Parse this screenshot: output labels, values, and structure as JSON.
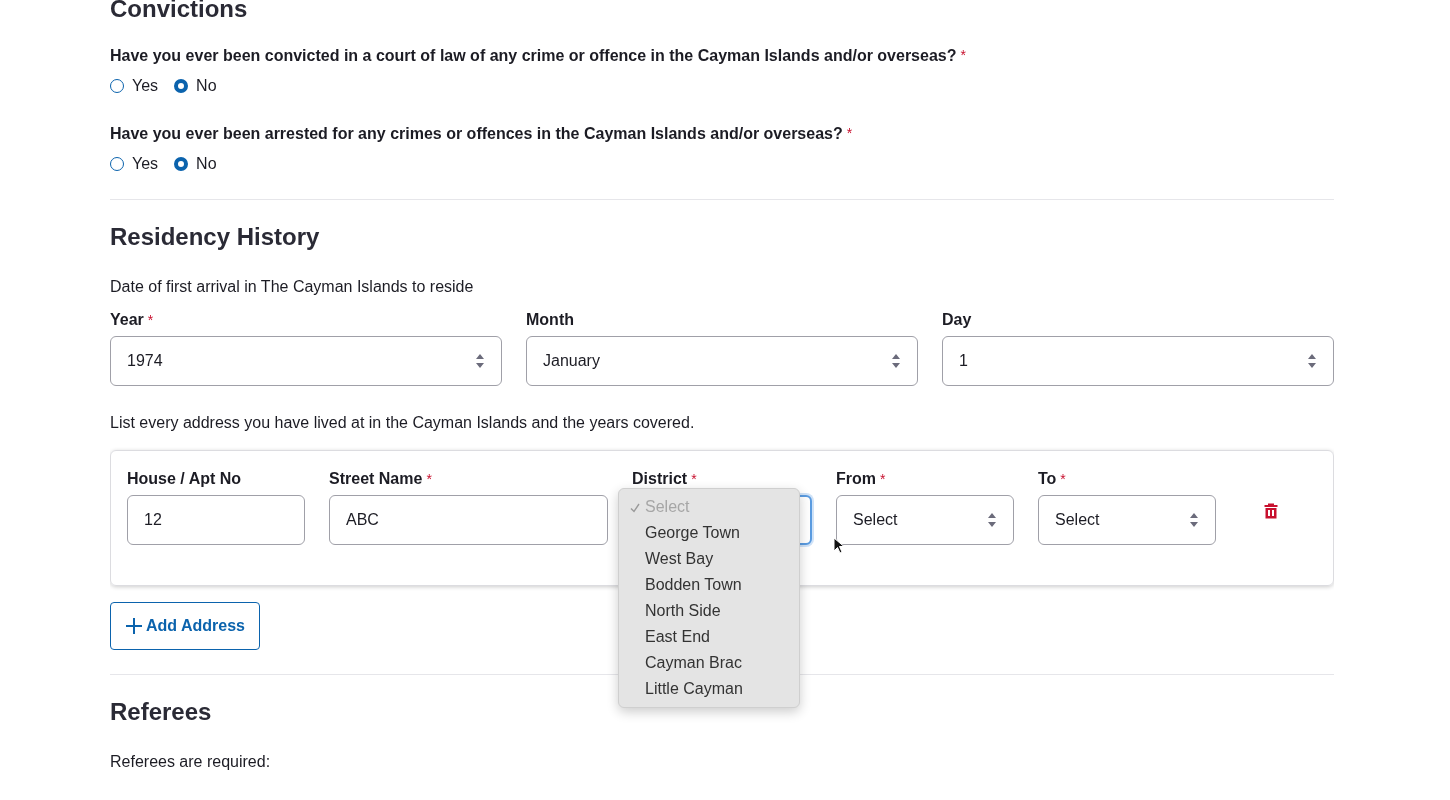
{
  "convictions": {
    "title": "Convictions",
    "questions": [
      {
        "text": "Have you ever been convicted in a court of law of any crime or offence in the Cayman Islands and/or overseas?",
        "mark": "*",
        "options": [
          {
            "label": "Yes",
            "selected": false
          },
          {
            "label": "No",
            "selected": true
          }
        ]
      },
      {
        "text": "Have you ever been arrested for any crimes or offences in the Cayman Islands and/or overseas?",
        "mark": "*",
        "options": [
          {
            "label": "Yes",
            "selected": false
          },
          {
            "label": "No",
            "selected": true
          }
        ]
      }
    ]
  },
  "residency": {
    "title": "Residency History",
    "arrival_text": "Date of first arrival in The Cayman Islands to reside",
    "date_fields": [
      {
        "label": "Year",
        "mark": "*",
        "value": "1974"
      },
      {
        "label": "Month",
        "value": "January"
      },
      {
        "label": "Day",
        "value": "1"
      }
    ],
    "address_text": "List every address you have lived at in the Cayman Islands and the years covered.",
    "address_fields": [
      {
        "label": "House / Apt No",
        "kind": "text",
        "value": "12"
      },
      {
        "label": "Street Name",
        "mark": "*",
        "kind": "text",
        "value": "ABC"
      },
      {
        "label": "District",
        "mark": "*",
        "kind": "select",
        "focused": true,
        "menu": [
          {
            "label": "Select",
            "selected": true,
            "disabled": true
          },
          {
            "label": "George Town",
            "selected": false,
            "disabled": false
          },
          {
            "label": "West Bay",
            "selected": false,
            "disabled": false
          },
          {
            "label": "Bodden Town",
            "selected": false,
            "disabled": false
          },
          {
            "label": "North Side",
            "selected": false,
            "disabled": false
          },
          {
            "label": "East End",
            "selected": false,
            "disabled": false
          },
          {
            "label": "Cayman Brac",
            "selected": false,
            "disabled": false
          },
          {
            "label": "Little Cayman",
            "selected": false,
            "disabled": false
          }
        ]
      },
      {
        "label": "From",
        "mark": "*",
        "kind": "select",
        "focused": false,
        "value": "Select"
      },
      {
        "label": "To",
        "mark": "*",
        "kind": "select",
        "focused": false,
        "value": "Select"
      }
    ],
    "add_button": "Add Address"
  },
  "referees": {
    "title": "Referees",
    "text": "Referees are required:"
  }
}
